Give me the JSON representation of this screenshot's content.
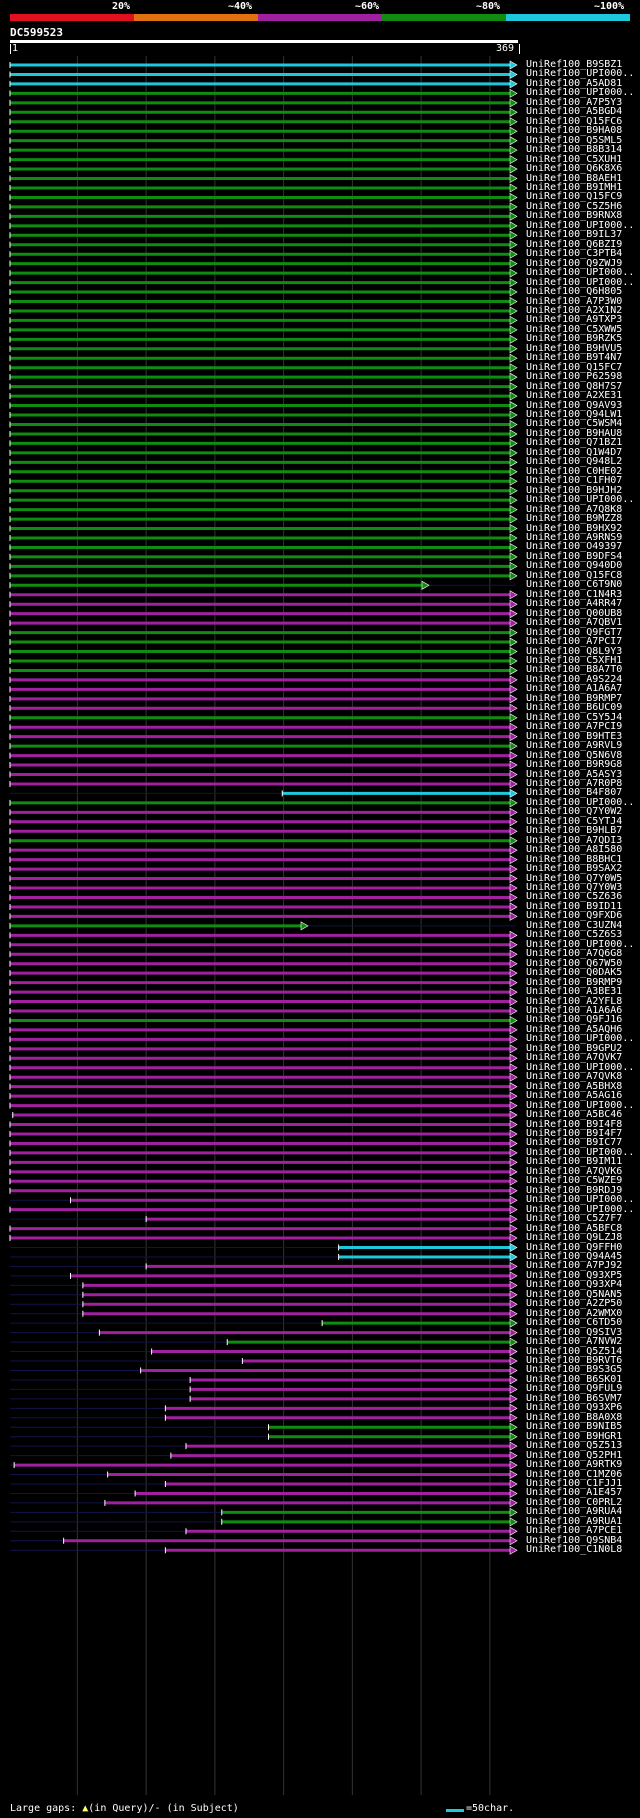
{
  "identity_legend": {
    "labels": [
      "20%",
      "~40%",
      "~60%",
      "~80%",
      "~100%"
    ],
    "colors": [
      "#e0101e",
      "#e07010",
      "#a020a0",
      "#108c10",
      "#1ec8dc"
    ]
  },
  "query": {
    "name": "DC599523",
    "start": "1",
    "end": "369"
  },
  "footer": {
    "gaps_prefix": "Large gaps: ",
    "query_marker": "▲",
    "query_text": "(in Query)/",
    "subject_marker": "-",
    "subject_text": " (in Subject)",
    "scale_label": "=50char."
  },
  "chart_data": {
    "type": "alignment",
    "query_length": 369,
    "hits": [
      {
        "name": "UniRef100_B9SBZ1",
        "start": 1,
        "end": 369,
        "color": "#1ec8dc"
      },
      {
        "name": "UniRef100_UPI000..",
        "start": 1,
        "end": 369,
        "color": "#1ec8dc"
      },
      {
        "name": "UniRef100_A5AD81",
        "start": 1,
        "end": 369,
        "color": "#1ec8dc"
      },
      {
        "name": "UniRef100_UPI000..",
        "start": 1,
        "end": 369,
        "color": "#108c10"
      },
      {
        "name": "UniRef100_A7P5Y3",
        "start": 1,
        "end": 369,
        "color": "#108c10"
      },
      {
        "name": "UniRef100_A5BGD4",
        "start": 1,
        "end": 369,
        "color": "#108c10"
      },
      {
        "name": "UniRef100_Q15FC6",
        "start": 1,
        "end": 369,
        "color": "#108c10"
      },
      {
        "name": "UniRef100_B9HA08",
        "start": 1,
        "end": 369,
        "color": "#108c10"
      },
      {
        "name": "UniRef100_Q5SML5",
        "start": 1,
        "end": 369,
        "color": "#108c10"
      },
      {
        "name": "UniRef100_B8B314",
        "start": 1,
        "end": 369,
        "color": "#108c10"
      },
      {
        "name": "UniRef100_C5XUH1",
        "start": 1,
        "end": 369,
        "color": "#108c10"
      },
      {
        "name": "UniRef100_Q6K8X6",
        "start": 1,
        "end": 369,
        "color": "#108c10"
      },
      {
        "name": "UniRef100_B8AEH1",
        "start": 1,
        "end": 369,
        "color": "#108c10"
      },
      {
        "name": "UniRef100_B9IMH1",
        "start": 1,
        "end": 369,
        "color": "#108c10"
      },
      {
        "name": "UniRef100_Q15FC9",
        "start": 1,
        "end": 369,
        "color": "#108c10"
      },
      {
        "name": "UniRef100_C5Z5H6",
        "start": 1,
        "end": 369,
        "color": "#108c10"
      },
      {
        "name": "UniRef100_B9RNX8",
        "start": 1,
        "end": 369,
        "color": "#108c10"
      },
      {
        "name": "UniRef100_UPI000..",
        "start": 1,
        "end": 369,
        "color": "#108c10"
      },
      {
        "name": "UniRef100_B9IL37",
        "start": 1,
        "end": 369,
        "color": "#108c10"
      },
      {
        "name": "UniRef100_Q6BZI9",
        "start": 1,
        "end": 369,
        "color": "#108c10"
      },
      {
        "name": "UniRef100_C3PTB4",
        "start": 1,
        "end": 369,
        "color": "#108c10"
      },
      {
        "name": "UniRef100_Q9ZWJ9",
        "start": 1,
        "end": 369,
        "color": "#108c10"
      },
      {
        "name": "UniRef100_UPI000..",
        "start": 1,
        "end": 369,
        "color": "#108c10"
      },
      {
        "name": "UniRef100_UPI000..",
        "start": 1,
        "end": 369,
        "color": "#108c10"
      },
      {
        "name": "UniRef100_Q6H805",
        "start": 1,
        "end": 369,
        "color": "#108c10"
      },
      {
        "name": "UniRef100_A7P3W0",
        "start": 1,
        "end": 369,
        "color": "#108c10"
      },
      {
        "name": "UniRef100_A2X1N2",
        "start": 1,
        "end": 369,
        "color": "#108c10"
      },
      {
        "name": "UniRef100_A9TXP3",
        "start": 1,
        "end": 369,
        "color": "#108c10"
      },
      {
        "name": "UniRef100_C5XWW5",
        "start": 1,
        "end": 369,
        "color": "#108c10"
      },
      {
        "name": "UniRef100_B9RZK5",
        "start": 1,
        "end": 369,
        "color": "#108c10"
      },
      {
        "name": "UniRef100_B9HVU5",
        "start": 1,
        "end": 369,
        "color": "#108c10"
      },
      {
        "name": "UniRef100_B9T4N7",
        "start": 1,
        "end": 369,
        "color": "#108c10"
      },
      {
        "name": "UniRef100_Q15FC7",
        "start": 1,
        "end": 369,
        "color": "#108c10"
      },
      {
        "name": "UniRef100_P62598",
        "start": 1,
        "end": 369,
        "color": "#108c10"
      },
      {
        "name": "UniRef100_Q8H7S7",
        "start": 1,
        "end": 369,
        "color": "#108c10"
      },
      {
        "name": "UniRef100_A2XE31",
        "start": 1,
        "end": 369,
        "color": "#108c10"
      },
      {
        "name": "UniRef100_Q9AV93",
        "start": 1,
        "end": 369,
        "color": "#108c10"
      },
      {
        "name": "UniRef100_Q94LW1",
        "start": 1,
        "end": 369,
        "color": "#108c10"
      },
      {
        "name": "UniRef100_C5WSM4",
        "start": 1,
        "end": 369,
        "color": "#108c10"
      },
      {
        "name": "UniRef100_B9HAU8",
        "start": 1,
        "end": 369,
        "color": "#108c10"
      },
      {
        "name": "UniRef100_Q71BZ1",
        "start": 1,
        "end": 369,
        "color": "#108c10"
      },
      {
        "name": "UniRef100_Q1W4D7",
        "start": 1,
        "end": 369,
        "color": "#108c10"
      },
      {
        "name": "UniRef100_Q948L2",
        "start": 1,
        "end": 369,
        "color": "#108c10"
      },
      {
        "name": "UniRef100_C0HE02",
        "start": 1,
        "end": 369,
        "color": "#108c10"
      },
      {
        "name": "UniRef100_C1FH07",
        "start": 1,
        "end": 369,
        "color": "#108c10"
      },
      {
        "name": "UniRef100_B9HJH2",
        "start": 1,
        "end": 369,
        "color": "#108c10"
      },
      {
        "name": "UniRef100_UPI000..",
        "start": 1,
        "end": 369,
        "color": "#108c10"
      },
      {
        "name": "UniRef100_A7Q8K8",
        "start": 1,
        "end": 369,
        "color": "#108c10"
      },
      {
        "name": "UniRef100_B9MZZ8",
        "start": 1,
        "end": 369,
        "color": "#108c10"
      },
      {
        "name": "UniRef100_B9HX92",
        "start": 1,
        "end": 369,
        "color": "#108c10"
      },
      {
        "name": "UniRef100_A9RNS9",
        "start": 1,
        "end": 369,
        "color": "#108c10"
      },
      {
        "name": "UniRef100_O49397",
        "start": 1,
        "end": 369,
        "color": "#108c10"
      },
      {
        "name": "UniRef100_B9DFS4",
        "start": 1,
        "end": 369,
        "color": "#108c10"
      },
      {
        "name": "UniRef100_Q940D0",
        "start": 1,
        "end": 369,
        "color": "#108c10"
      },
      {
        "name": "UniRef100_Q15FC8",
        "start": 1,
        "end": 369,
        "color": "#108c10"
      },
      {
        "name": "UniRef100_C6T9N0",
        "start": 1,
        "end": 305,
        "color": "#108c10"
      },
      {
        "name": "UniRef100_C1N4R3",
        "start": 1,
        "end": 369,
        "color": "#a020a0"
      },
      {
        "name": "UniRef100_A4RR47",
        "start": 1,
        "end": 369,
        "color": "#a020a0"
      },
      {
        "name": "UniRef100_Q00UB8",
        "start": 1,
        "end": 369,
        "color": "#a020a0"
      },
      {
        "name": "UniRef100_A7QBV1",
        "start": 1,
        "end": 369,
        "color": "#a020a0"
      },
      {
        "name": "UniRef100_Q9FGT7",
        "start": 1,
        "end": 369,
        "color": "#108c10"
      },
      {
        "name": "UniRef100_A7PCI7",
        "start": 1,
        "end": 369,
        "color": "#108c10"
      },
      {
        "name": "UniRef100_Q8L9Y3",
        "start": 1,
        "end": 369,
        "color": "#108c10"
      },
      {
        "name": "UniRef100_C5XFH1",
        "start": 1,
        "end": 369,
        "color": "#108c10"
      },
      {
        "name": "UniRef100_B8A7T0",
        "start": 1,
        "end": 369,
        "color": "#108c10"
      },
      {
        "name": "UniRef100_A9S224",
        "start": 1,
        "end": 369,
        "color": "#a020a0"
      },
      {
        "name": "UniRef100_A1A6A7",
        "start": 1,
        "end": 369,
        "color": "#a020a0"
      },
      {
        "name": "UniRef100_B9RMP7",
        "start": 1,
        "end": 369,
        "color": "#a020a0"
      },
      {
        "name": "UniRef100_B6UC09",
        "start": 1,
        "end": 369,
        "color": "#a020a0"
      },
      {
        "name": "UniRef100_C5Y5J4",
        "start": 1,
        "end": 369,
        "color": "#108c10"
      },
      {
        "name": "UniRef100_A7PCI9",
        "start": 1,
        "end": 369,
        "color": "#a020a0"
      },
      {
        "name": "UniRef100_B9HTE3",
        "start": 1,
        "end": 369,
        "color": "#a020a0"
      },
      {
        "name": "UniRef100_A9RVL9",
        "start": 1,
        "end": 369,
        "color": "#108c10"
      },
      {
        "name": "UniRef100_Q5N6V8",
        "start": 1,
        "end": 369,
        "color": "#a020a0"
      },
      {
        "name": "UniRef100_B9R9G8",
        "start": 1,
        "end": 369,
        "color": "#a020a0"
      },
      {
        "name": "UniRef100_A5ASY3",
        "start": 1,
        "end": 369,
        "color": "#a020a0"
      },
      {
        "name": "UniRef100_A7R0P8",
        "start": 1,
        "end": 369,
        "color": "#a020a0"
      },
      {
        "name": "UniRef100_B4F807",
        "start": 199,
        "end": 369,
        "color": "#1ec8dc"
      },
      {
        "name": "UniRef100_UPI000..",
        "start": 1,
        "end": 369,
        "color": "#108c10"
      },
      {
        "name": "UniRef100_Q7Y0W2",
        "start": 1,
        "end": 369,
        "color": "#a020a0"
      },
      {
        "name": "UniRef100_C5YTJ4",
        "start": 1,
        "end": 369,
        "color": "#a020a0"
      },
      {
        "name": "UniRef100_B9HLB7",
        "start": 1,
        "end": 369,
        "color": "#a020a0"
      },
      {
        "name": "UniRef100_A7QDI3",
        "start": 1,
        "end": 369,
        "color": "#108c10"
      },
      {
        "name": "UniRef100_A8I580",
        "start": 1,
        "end": 369,
        "color": "#a020a0"
      },
      {
        "name": "UniRef100_B8BHC1",
        "start": 1,
        "end": 369,
        "color": "#a020a0"
      },
      {
        "name": "UniRef100_B9SAX2",
        "start": 1,
        "end": 369,
        "color": "#a020a0"
      },
      {
        "name": "UniRef100_Q7Y0W5",
        "start": 1,
        "end": 369,
        "color": "#a020a0"
      },
      {
        "name": "UniRef100_Q7Y0W3",
        "start": 1,
        "end": 369,
        "color": "#a020a0"
      },
      {
        "name": "UniRef100_C5Z636",
        "start": 1,
        "end": 369,
        "color": "#a020a0"
      },
      {
        "name": "UniRef100_B9ID11",
        "start": 1,
        "end": 369,
        "color": "#a020a0"
      },
      {
        "name": "UniRef100_Q9FXD6",
        "start": 1,
        "end": 369,
        "color": "#a020a0"
      },
      {
        "name": "UniRef100_C3UZN4",
        "start": 1,
        "end": 217,
        "color": "#108c10"
      },
      {
        "name": "UniRef100_C5Z6S3",
        "start": 1,
        "end": 369,
        "color": "#a020a0"
      },
      {
        "name": "UniRef100_UPI000..",
        "start": 1,
        "end": 369,
        "color": "#a020a0"
      },
      {
        "name": "UniRef100_A7Q6G8",
        "start": 1,
        "end": 369,
        "color": "#a020a0"
      },
      {
        "name": "UniRef100_Q67W50",
        "start": 1,
        "end": 369,
        "color": "#a020a0"
      },
      {
        "name": "UniRef100_Q0DAK5",
        "start": 1,
        "end": 369,
        "color": "#a020a0"
      },
      {
        "name": "UniRef100_B9RMP9",
        "start": 1,
        "end": 369,
        "color": "#a020a0"
      },
      {
        "name": "UniRef100_A3BE31",
        "start": 1,
        "end": 369,
        "color": "#a020a0"
      },
      {
        "name": "UniRef100_A2YFL8",
        "start": 1,
        "end": 369,
        "color": "#a020a0"
      },
      {
        "name": "UniRef100_A1A6A6",
        "start": 1,
        "end": 369,
        "color": "#a020a0"
      },
      {
        "name": "UniRef100_Q9FJ16",
        "start": 1,
        "end": 369,
        "color": "#108c10"
      },
      {
        "name": "UniRef100_A5AQH6",
        "start": 1,
        "end": 369,
        "color": "#a020a0"
      },
      {
        "name": "UniRef100_UPI000..",
        "start": 1,
        "end": 369,
        "color": "#a020a0"
      },
      {
        "name": "UniRef100_B9GPU2",
        "start": 1,
        "end": 369,
        "color": "#a020a0"
      },
      {
        "name": "UniRef100_A7QVK7",
        "start": 1,
        "end": 369,
        "color": "#a020a0"
      },
      {
        "name": "UniRef100_UPI000..",
        "start": 1,
        "end": 369,
        "color": "#a020a0"
      },
      {
        "name": "UniRef100_A7QVK8",
        "start": 1,
        "end": 369,
        "color": "#a020a0"
      },
      {
        "name": "UniRef100_A5BHX8",
        "start": 1,
        "end": 369,
        "color": "#a020a0"
      },
      {
        "name": "UniRef100_A5AG16",
        "start": 1,
        "end": 369,
        "color": "#a020a0"
      },
      {
        "name": "UniRef100_UPI000..",
        "start": 1,
        "end": 369,
        "color": "#a020a0"
      },
      {
        "name": "UniRef100_A5BC46",
        "start": 3,
        "end": 369,
        "color": "#a020a0"
      },
      {
        "name": "UniRef100_B9I4F8",
        "start": 1,
        "end": 369,
        "color": "#a020a0"
      },
      {
        "name": "UniRef100_B9I4F7",
        "start": 1,
        "end": 369,
        "color": "#a020a0"
      },
      {
        "name": "UniRef100_B9IC77",
        "start": 1,
        "end": 369,
        "color": "#a020a0"
      },
      {
        "name": "UniRef100_UPI000..",
        "start": 1,
        "end": 369,
        "color": "#a020a0"
      },
      {
        "name": "UniRef100_B9IM11",
        "start": 1,
        "end": 369,
        "color": "#a020a0"
      },
      {
        "name": "UniRef100_A7QVK6",
        "start": 1,
        "end": 369,
        "color": "#a020a0"
      },
      {
        "name": "UniRef100_C5WZE9",
        "start": 1,
        "end": 369,
        "color": "#a020a0"
      },
      {
        "name": "UniRef100_B9RDJ9",
        "start": 1,
        "end": 369,
        "color": "#a020a0"
      },
      {
        "name": "UniRef100_UPI000..",
        "start": 45,
        "end": 369,
        "color": "#a020a0"
      },
      {
        "name": "UniRef100_UPI000..",
        "start": 1,
        "end": 369,
        "color": "#a020a0"
      },
      {
        "name": "UniRef100_C5Z7F7",
        "start": 100,
        "end": 369,
        "color": "#a020a0"
      },
      {
        "name": "UniRef100_A5BFC8",
        "start": 1,
        "end": 369,
        "color": "#a020a0"
      },
      {
        "name": "UniRef100_Q9LZJ8",
        "start": 1,
        "end": 369,
        "color": "#a020a0"
      },
      {
        "name": "UniRef100_Q9FFH0",
        "start": 240,
        "end": 369,
        "color": "#1ec8dc"
      },
      {
        "name": "UniRef100_Q94A45",
        "start": 240,
        "end": 369,
        "color": "#1ec8dc"
      },
      {
        "name": "UniRef100_A7PJ92",
        "start": 100,
        "end": 369,
        "color": "#a020a0"
      },
      {
        "name": "UniRef100_Q93XP5",
        "start": 45,
        "end": 369,
        "color": "#a020a0"
      },
      {
        "name": "UniRef100_Q93XP4",
        "start": 54,
        "end": 369,
        "color": "#a020a0"
      },
      {
        "name": "UniRef100_Q5NAN5",
        "start": 54,
        "end": 369,
        "color": "#a020a0"
      },
      {
        "name": "UniRef100_A2ZP50",
        "start": 54,
        "end": 369,
        "color": "#a020a0"
      },
      {
        "name": "UniRef100_A2WMX0",
        "start": 54,
        "end": 369,
        "color": "#a020a0"
      },
      {
        "name": "UniRef100_C6TD50",
        "start": 228,
        "end": 369,
        "color": "#108c10"
      },
      {
        "name": "UniRef100_Q9SIV3",
        "start": 66,
        "end": 369,
        "color": "#a020a0"
      },
      {
        "name": "UniRef100_A7NVW2",
        "start": 159,
        "end": 369,
        "color": "#108c10"
      },
      {
        "name": "UniRef100_Q5Z514",
        "start": 104,
        "end": 369,
        "color": "#a020a0"
      },
      {
        "name": "UniRef100_B9RVT6",
        "start": 170,
        "end": 369,
        "color": "#a020a0"
      },
      {
        "name": "UniRef100_B9S3G5",
        "start": 96,
        "end": 369,
        "color": "#a020a0"
      },
      {
        "name": "UniRef100_B6SK01",
        "start": 132,
        "end": 369,
        "color": "#a020a0"
      },
      {
        "name": "UniRef100_Q9FUL9",
        "start": 132,
        "end": 369,
        "color": "#a020a0"
      },
      {
        "name": "UniRef100_B6SVM7",
        "start": 132,
        "end": 369,
        "color": "#a020a0"
      },
      {
        "name": "UniRef100_Q93XP6",
        "start": 114,
        "end": 369,
        "color": "#a020a0"
      },
      {
        "name": "UniRef100_B8A0X8",
        "start": 114,
        "end": 369,
        "color": "#a020a0"
      },
      {
        "name": "UniRef100_B9NIB5",
        "start": 189,
        "end": 369,
        "color": "#108c10"
      },
      {
        "name": "UniRef100_B9HGR1",
        "start": 189,
        "end": 369,
        "color": "#108c10"
      },
      {
        "name": "UniRef100_Q5Z513",
        "start": 129,
        "end": 369,
        "color": "#a020a0"
      },
      {
        "name": "UniRef100_Q52PH1",
        "start": 118,
        "end": 369,
        "color": "#a020a0"
      },
      {
        "name": "UniRef100_A9RTK9",
        "start": 4,
        "end": 369,
        "color": "#a020a0"
      },
      {
        "name": "UniRef100_C1MZ06",
        "start": 72,
        "end": 369,
        "color": "#a020a0"
      },
      {
        "name": "UniRef100_C1FJJ1",
        "start": 114,
        "end": 369,
        "color": "#a020a0"
      },
      {
        "name": "UniRef100_A1E457",
        "start": 92,
        "end": 369,
        "color": "#a020a0"
      },
      {
        "name": "UniRef100_C0PRL2",
        "start": 70,
        "end": 369,
        "color": "#a020a0"
      },
      {
        "name": "UniRef100_A9RUA4",
        "start": 155,
        "end": 369,
        "color": "#108c10"
      },
      {
        "name": "UniRef100_A9RUA1",
        "start": 155,
        "end": 369,
        "color": "#108c10"
      },
      {
        "name": "UniRef100_A7PCE1",
        "start": 129,
        "end": 369,
        "color": "#a020a0"
      },
      {
        "name": "UniRef100_Q9SNB4",
        "start": 40,
        "end": 369,
        "color": "#a020a0"
      },
      {
        "name": "UniRef100_C1N0L8",
        "start": 114,
        "end": 369,
        "color": "#a020a0"
      }
    ]
  }
}
